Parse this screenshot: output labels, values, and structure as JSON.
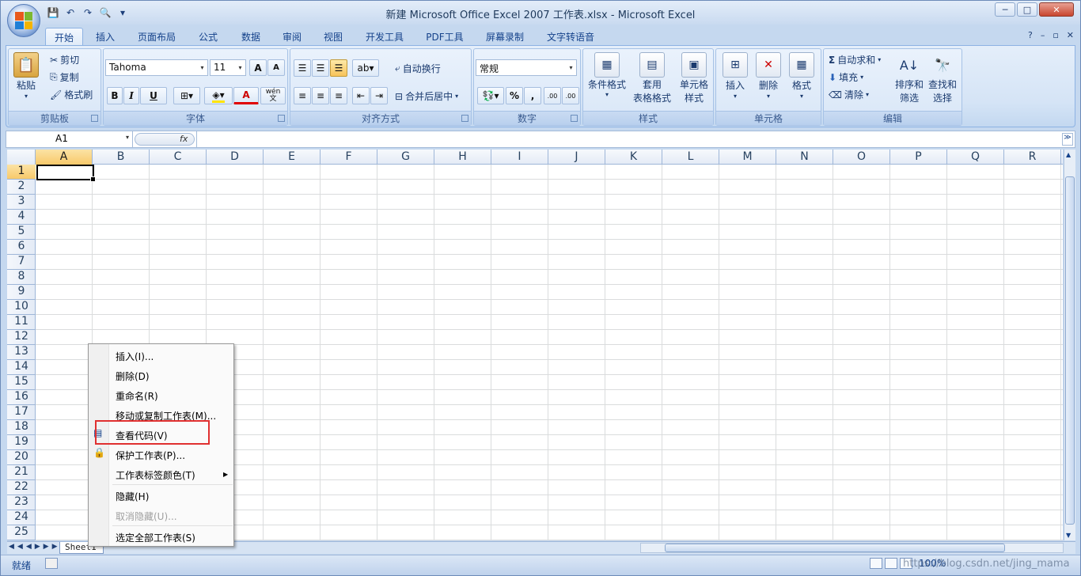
{
  "window": {
    "title": "新建 Microsoft Office Excel 2007 工作表.xlsx - Microsoft Excel",
    "controls": [
      "─",
      "□",
      "✕"
    ]
  },
  "ribbon_tabs": [
    "开始",
    "插入",
    "页面布局",
    "公式",
    "数据",
    "审阅",
    "视图",
    "开发工具",
    "PDF工具",
    "屏幕录制",
    "文字转语音"
  ],
  "ribbon_right": [
    "?",
    "–",
    "▫",
    "✕"
  ],
  "groups": {
    "clipboard": {
      "label": "剪贴板",
      "paste": "粘贴",
      "cut": "剪切",
      "copy": "复制",
      "format_painter": "格式刷"
    },
    "font": {
      "label": "字体",
      "font_name": "Tahoma",
      "font_size": "11",
      "bold": "B",
      "italic": "I",
      "underline": "U",
      "grow": "A",
      "shrink": "A",
      "font_color": "A",
      "wen": "wén\n文"
    },
    "alignment": {
      "label": "对齐方式",
      "wrap": "自动换行",
      "merge": "合并后居中"
    },
    "number": {
      "label": "数字",
      "format": "常规",
      "percent": "%",
      "comma": ",",
      "inc_decimal": ".00",
      "dec_decimal": ".00"
    },
    "styles": {
      "label": "样式",
      "conditional": "条件格式",
      "table_1": "套用",
      "table_2": "表格格式",
      "cell_1": "单元格",
      "cell_2": "样式"
    },
    "cells": {
      "label": "单元格",
      "insert": "插入",
      "delete": "删除",
      "format": "格式"
    },
    "editing": {
      "label": "编辑",
      "autosum": "自动求和",
      "fill": "填充",
      "clear": "清除",
      "sort_1": "排序和",
      "sort_2": "筛选",
      "find_1": "查找和",
      "find_2": "选择"
    }
  },
  "formula_bar": {
    "name_box": "A1",
    "fx": "fx"
  },
  "columns": [
    "A",
    "B",
    "C",
    "D",
    "E",
    "F",
    "G",
    "H",
    "I",
    "J",
    "K",
    "L",
    "M",
    "N",
    "O",
    "P",
    "Q",
    "R"
  ],
  "rows": [
    "1",
    "2",
    "3",
    "4",
    "5",
    "6",
    "7",
    "8",
    "9",
    "10",
    "11",
    "12",
    "13",
    "14",
    "15",
    "16",
    "17",
    "18",
    "19",
    "20",
    "21",
    "22",
    "23",
    "24",
    "25"
  ],
  "sheet_tab": "Sheet1",
  "status": {
    "ready": "就绪",
    "zoom": "100%",
    "watermark": "https://blog.csdn.net/jing_mama"
  },
  "context_menu": {
    "items": [
      {
        "label": "插入(I)..."
      },
      {
        "label": "删除(D)"
      },
      {
        "label": "重命名(R)"
      },
      {
        "label": "移动或复制工作表(M)..."
      },
      {
        "label": "查看代码(V)"
      },
      {
        "label": "保护工作表(P)..."
      },
      {
        "label": "工作表标签颜色(T)"
      },
      {
        "label": "隐藏(H)"
      },
      {
        "label": "取消隐藏(U)..."
      },
      {
        "label": "选定全部工作表(S)"
      }
    ]
  },
  "colors": {
    "highlight_box": "#e03030",
    "selected_header": "#f8c96a"
  }
}
